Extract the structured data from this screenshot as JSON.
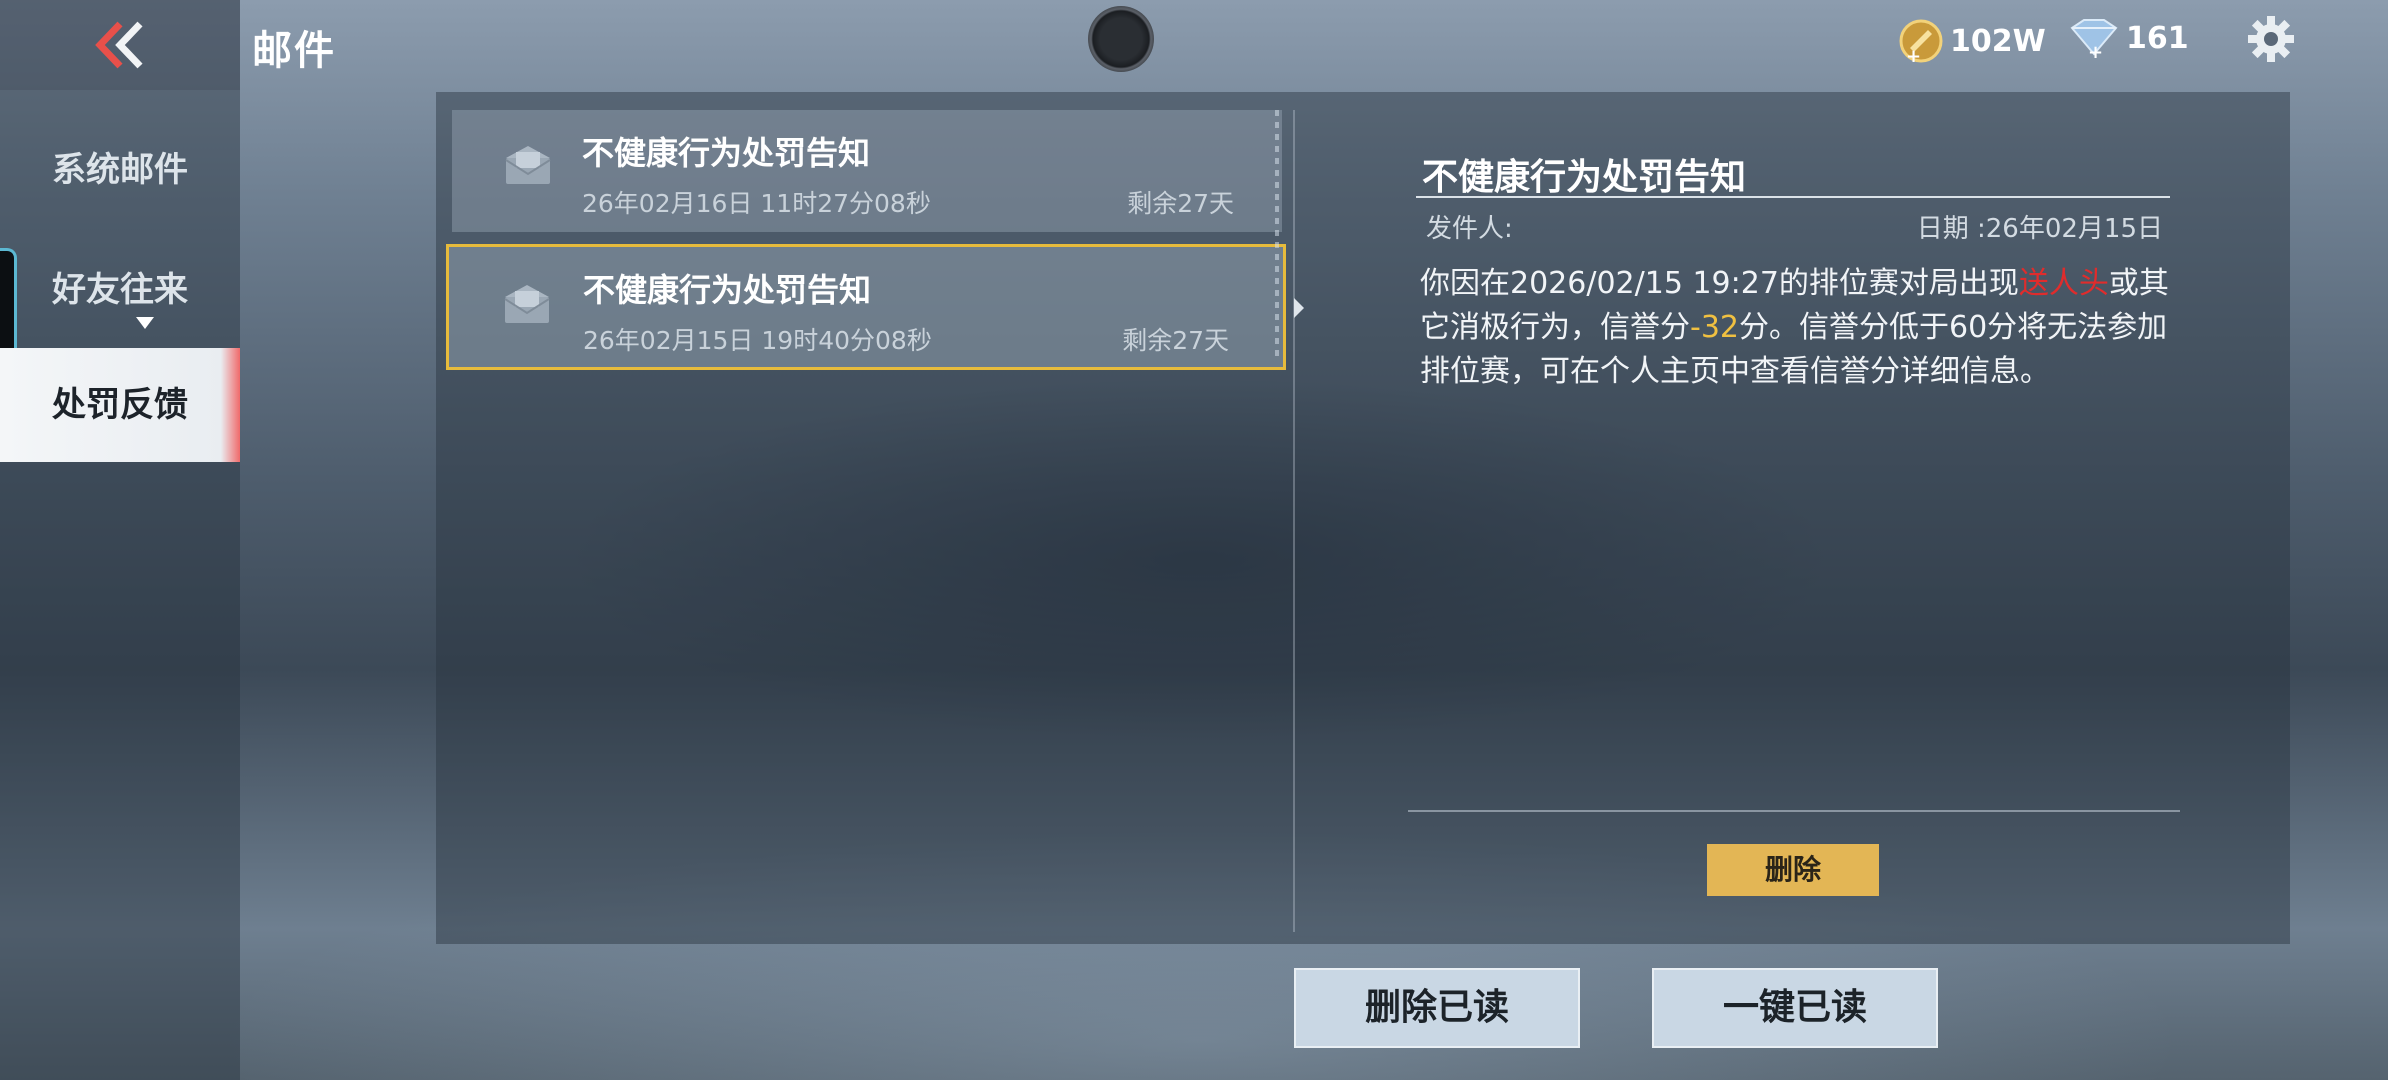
{
  "header": {
    "title": "邮件",
    "gold": "102W",
    "diamond": "161"
  },
  "sidebar": {
    "items": [
      {
        "label": "系统邮件"
      },
      {
        "label": "好友往来"
      },
      {
        "label": "处罚反馈"
      }
    ]
  },
  "mail_list": [
    {
      "title": "不健康行为处罚告知",
      "date": "26年02月16日 11时27分08秒",
      "remaining": "剩余27天"
    },
    {
      "title": "不健康行为处罚告知",
      "date": "26年02月15日 19时40分08秒",
      "remaining": "剩余27天"
    }
  ],
  "detail": {
    "title": "不健康行为处罚告知",
    "sender": "发件人:",
    "date": "日期 :26年02月15日",
    "body_part1": "你因在2026/02/15 19:27的排位赛对局出现",
    "body_red": "送人头",
    "body_part2": "或其它消极行为，信誉分",
    "body_score": "-32",
    "body_part3": "分。信誉分低于60分将无法参加排位赛，可在个人主页中查看信誉分详细信息。",
    "delete_label": "删除"
  },
  "actions": {
    "delete_read": "删除已读",
    "mark_all_read": "一键已读"
  },
  "colors": {
    "accent": "#e7bb3c",
    "back_arrow": "#e8504a"
  }
}
